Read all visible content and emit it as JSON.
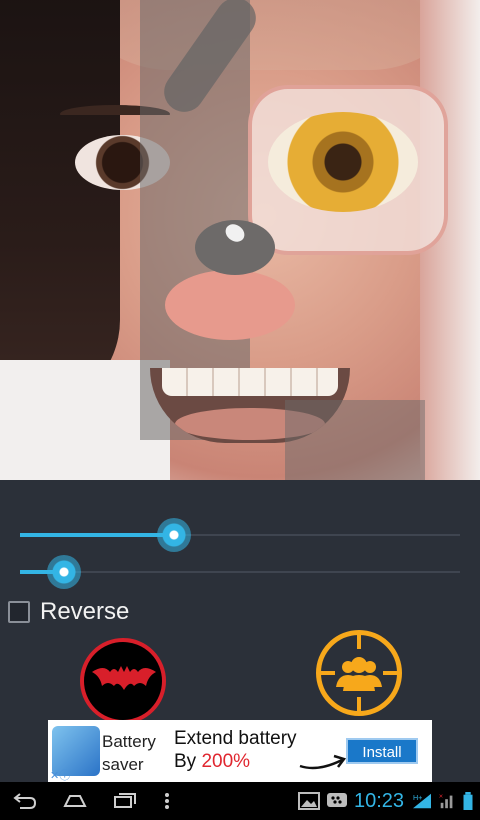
{
  "controls": {
    "slider1": {
      "value_fraction": 0.35
    },
    "slider2": {
      "value_fraction": 0.1
    },
    "reverse": {
      "label": "Reverse",
      "checked": false
    }
  },
  "buttons": {
    "bat": {
      "icon": "bat-icon",
      "color": "#d81f2a"
    },
    "people": {
      "icon": "people-icon",
      "color": "#f7a81b"
    }
  },
  "ad": {
    "app_name_line1": "Battery",
    "app_name_line2": "saver",
    "headline_line1": "Extend battery",
    "headline_line2_prefix": "By ",
    "headline_line2_highlight": "200%",
    "install_label": "Install"
  },
  "status_bar": {
    "time": "10:23",
    "icons": [
      "back-icon",
      "home-icon",
      "recent-apps-icon",
      "menu-icon",
      "gallery-icon",
      "bbm-icon",
      "wifi-icon",
      "signal-icon",
      "battery-icon"
    ]
  },
  "colors": {
    "accent": "#33b5e5",
    "background": "#2b3039"
  }
}
